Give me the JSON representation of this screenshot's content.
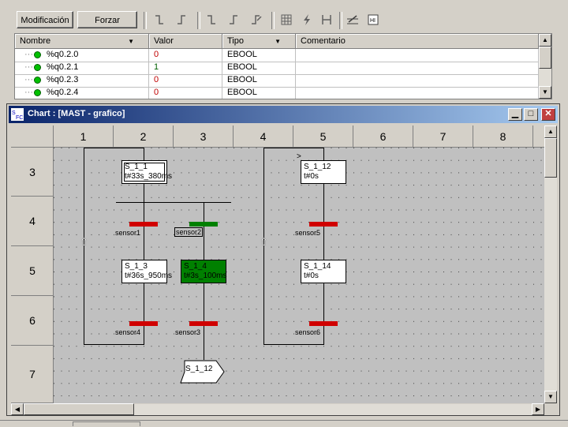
{
  "toolbar": {
    "modify_label": "Modificación",
    "force_label": "Forzar"
  },
  "vartable": {
    "columns": [
      "Nombre",
      "Valor",
      "Tipo",
      "Comentario"
    ],
    "rows": [
      {
        "name": "%q0.2.0",
        "value": "0",
        "type": "EBOOL",
        "comment": ""
      },
      {
        "name": "%q0.2.1",
        "value": "1",
        "type": "EBOOL",
        "comment": ""
      },
      {
        "name": "%q0.2.3",
        "value": "0",
        "type": "EBOOL",
        "comment": ""
      },
      {
        "name": "%q0.2.4",
        "value": "0",
        "type": "EBOOL",
        "comment": ""
      }
    ]
  },
  "chart_window": {
    "title": "Chart : [MAST - grafico]",
    "columns": [
      "1",
      "2",
      "3",
      "4",
      "5",
      "6",
      "7",
      "8"
    ],
    "rows": [
      "3",
      "4",
      "5",
      "6",
      "7"
    ],
    "steps": [
      {
        "id": "S_1_1",
        "time": "t#33s_380ms",
        "active": false
      },
      {
        "id": "S_1_12",
        "time": "t#0s",
        "active": false
      },
      {
        "id": "S_1_3",
        "time": "t#36s_950ms",
        "active": false
      },
      {
        "id": "S_1_4",
        "time": "t#3s_100ms",
        "active": true
      },
      {
        "id": "S_1_14",
        "time": "t#0s",
        "active": false
      }
    ],
    "transitions": [
      "sensor1",
      "sensor2",
      "sensor5",
      "sensor4",
      "sensor3",
      "sensor6"
    ],
    "jump_label": "S_1_12",
    "jump_marker": ">"
  },
  "colors": {
    "transition_false": "#d00000",
    "transition_true": "#008000",
    "active_step": "#008000",
    "status_led": "#00c000",
    "value_zero": "#c00000"
  }
}
